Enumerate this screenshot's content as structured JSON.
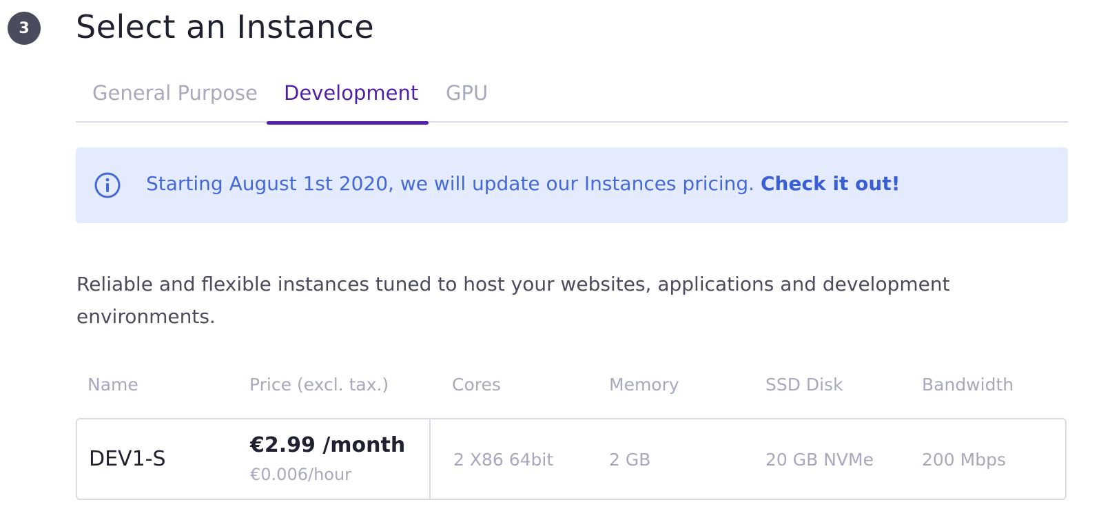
{
  "step": {
    "number": "3",
    "title": "Select an Instance"
  },
  "tabs": [
    {
      "label": "General Purpose",
      "active": false
    },
    {
      "label": "Development",
      "active": true
    },
    {
      "label": "GPU",
      "active": false
    }
  ],
  "banner": {
    "icon": "info-circle-icon",
    "text": "Starting August 1st 2020, we will update our Instances pricing.",
    "link_label": "Check it out!"
  },
  "description": "Reliable and flexible instances tuned to host your websites, applications and development environments.",
  "table": {
    "headers": {
      "name": "Name",
      "price": "Price (excl. tax.)",
      "cores": "Cores",
      "memory": "Memory",
      "disk": "SSD Disk",
      "bandwidth": "Bandwidth"
    },
    "rows": [
      {
        "name": "DEV1-S",
        "price_month": "€2.99 /month",
        "price_hour": "€0.006/hour",
        "cores": "2 X86 64bit",
        "memory": "2 GB",
        "disk": "20 GB NVMe",
        "bandwidth": "200 Mbps"
      }
    ]
  },
  "colors": {
    "accent": "#4f1fa6",
    "banner_bg": "#e4ebfc",
    "banner_text": "#4468d8",
    "muted": "#a7a9bd",
    "border": "#d9dbe8"
  }
}
